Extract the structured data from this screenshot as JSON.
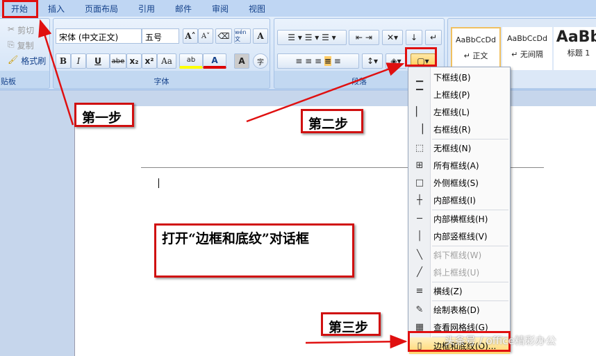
{
  "tabs": [
    "开始",
    "插入",
    "页面布局",
    "引用",
    "邮件",
    "审阅",
    "视图"
  ],
  "clipboard": {
    "cut": "剪切",
    "copy": "复制",
    "format_painter": "格式刷",
    "label": "贴板"
  },
  "font": {
    "name": "宋体 (中文正文)",
    "size": "五号",
    "label": "字体",
    "bold": "B",
    "italic": "I",
    "underline": "U",
    "strike": "abe",
    "sub": "x₂",
    "sup": "x²",
    "case": "Aa",
    "grow": "A˄",
    "shrink": "A˅",
    "phonetic": "wén文",
    "charborder": "A",
    "shade": "A",
    "enclose": "字",
    "color": "A",
    "highlight": "ab"
  },
  "paragraph": {
    "label": "段落"
  },
  "styles": [
    {
      "preview": "AaBbCcDd",
      "name": "↵ 正文"
    },
    {
      "preview": "AaBbCcDd",
      "name": "↵ 无间隔"
    },
    {
      "preview": "AaBb",
      "name": "标题 1"
    }
  ],
  "menu": [
    {
      "label": "下框线(B)",
      "icon": "bottom-border-icon",
      "glyph": "▁"
    },
    {
      "label": "上框线(P)",
      "icon": "top-border-icon",
      "glyph": "▔"
    },
    {
      "label": "左框线(L)",
      "icon": "left-border-icon",
      "glyph": "▏"
    },
    {
      "label": "右框线(R)",
      "icon": "right-border-icon",
      "glyph": "▕"
    },
    {
      "label": "无框线(N)",
      "icon": "no-border-icon",
      "glyph": "⬚"
    },
    {
      "label": "所有框线(A)",
      "icon": "all-borders-icon",
      "glyph": "⊞"
    },
    {
      "label": "外侧框线(S)",
      "icon": "outside-borders-icon",
      "glyph": "□"
    },
    {
      "label": "内部框线(I)",
      "icon": "inside-borders-icon",
      "glyph": "┼"
    },
    {
      "label": "内部横框线(H)",
      "icon": "inside-horizontal-icon",
      "glyph": "─"
    },
    {
      "label": "内部竖框线(V)",
      "icon": "inside-vertical-icon",
      "glyph": "│"
    },
    {
      "label": "斜下框线(W)",
      "icon": "diagonal-down-icon",
      "glyph": "╲",
      "disabled": true
    },
    {
      "label": "斜上框线(U)",
      "icon": "diagonal-up-icon",
      "glyph": "╱",
      "disabled": true
    },
    {
      "label": "横线(Z)",
      "icon": "horizontal-line-icon",
      "glyph": "≡"
    },
    {
      "label": "绘制表格(D)",
      "icon": "draw-table-icon",
      "glyph": "✎"
    },
    {
      "label": "查看网格线(G)",
      "icon": "view-gridlines-icon",
      "glyph": "▦"
    },
    {
      "label": "边框和底纹(O)...",
      "icon": "borders-shading-icon",
      "glyph": "▯"
    }
  ],
  "annotations": {
    "step1": "第一步",
    "step2": "第二步",
    "step3": "第三步",
    "instruction": "打开“边框和底纹”对话框"
  },
  "watermark": "头条号 / office精彩办公",
  "colors": {
    "accent": "#e01010"
  }
}
